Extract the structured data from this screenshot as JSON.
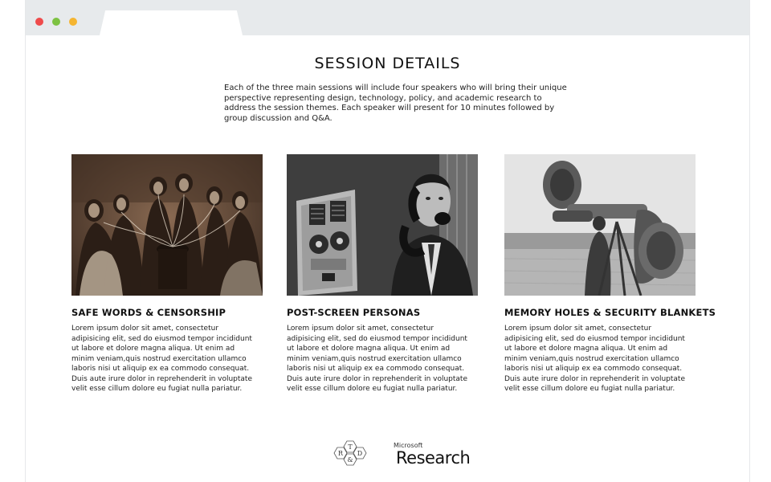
{
  "window": {
    "controls": [
      "close",
      "minimize",
      "maximize"
    ]
  },
  "page": {
    "title": "SESSION DETAILS",
    "intro": "Each of the three main sessions will include four speakers who will bring their unique perspective representing design, technology, policy, and academic research to address the session themes. Each speaker will present for 10 minutes followed by group discussion and Q&A."
  },
  "sessions": [
    {
      "title": "SAFE WORDS & CENSORSHIP",
      "body": "Lorem ipsum dolor sit amet, consectetur adipisicing elit, sed do eiusmod tempor incididunt ut labore et dolore magna aliqua. Ut enim ad minim veniam,quis nostrud exercitation ullamco laboris nisi ut aliquip ex ea commodo consequat. Duis aute irure dolor in reprehenderit in voluptate velit esse cillum dolore eu fugiat nulla pariatur.",
      "image": "sepia-photo-women-listening-to-phonograph"
    },
    {
      "title": "POST-SCREEN PERSONAS",
      "body": "Lorem ipsum dolor sit amet, consectetur adipisicing elit, sed do eiusmod tempor incididunt ut labore et dolore magna aliqua. Ut enim ad minim veniam,quis nostrud exercitation ullamco laboris nisi ut aliquip ex ea commodo consequat. Duis aute irure dolor in reprehenderit in voluptate velit esse cillum dolore eu fugiat nulla pariatur.",
      "image": "bw-photo-man-on-telephone-with-tape-machine"
    },
    {
      "title": "MEMORY HOLES & SECURITY BLANKETS",
      "body": "Lorem ipsum dolor sit amet, consectetur adipisicing elit, sed do eiusmod tempor incididunt ut labore et dolore magna aliqua. Ut enim ad minim veniam,quis nostrud exercitation ullamco laboris nisi ut aliquip ex ea commodo consequat. Duis aute irure dolor in reprehenderit in voluptate velit esse cillum dolore eu fugiat nulla pariatur.",
      "image": "bw-photo-acoustic-listening-horn-device"
    }
  ],
  "footer": {
    "rd_logo": [
      "T",
      "R",
      "&",
      "D"
    ],
    "microsoft": "Microsoft",
    "research": "Research"
  },
  "colors": {
    "chrome": "#e7eaec",
    "close": "#ef4b4b",
    "minimize": "#7dc242",
    "maximize": "#f5b531"
  }
}
